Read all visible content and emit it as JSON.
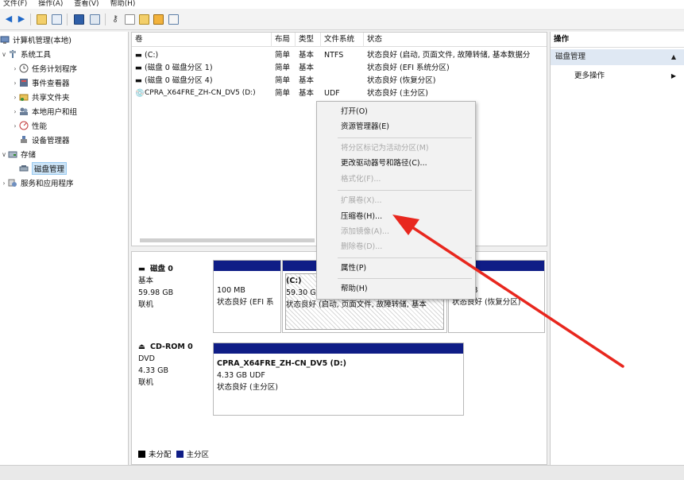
{
  "menubar": {
    "items": [
      "文件(F)",
      "操作(A)",
      "查看(V)",
      "帮助(H)"
    ]
  },
  "tree": {
    "items": [
      {
        "label": "计算机管理(本地)"
      },
      {
        "label": "系统工具"
      },
      {
        "label": "任务计划程序"
      },
      {
        "label": "事件查看器"
      },
      {
        "label": "共享文件夹"
      },
      {
        "label": "本地用户和组"
      },
      {
        "label": "性能"
      },
      {
        "label": "设备管理器"
      },
      {
        "label": "存储"
      },
      {
        "label": "磁盘管理"
      },
      {
        "label": "服务和应用程序"
      }
    ]
  },
  "volumes": {
    "headers": [
      "卷",
      "布局",
      "类型",
      "文件系统",
      "状态"
    ],
    "rows": [
      [
        "(C:)",
        "简单",
        "基本",
        "NTFS",
        "状态良好 (启动, 页面文件, 故障转储, 基本数据分"
      ],
      [
        "(磁盘 0 磁盘分区 1)",
        "简单",
        "基本",
        "",
        "状态良好 (EFI 系统分区)"
      ],
      [
        "(磁盘 0 磁盘分区 4)",
        "简单",
        "基本",
        "",
        "状态良好 (恢复分区)"
      ],
      [
        "CPRA_X64FRE_ZH-CN_DV5 (D:)",
        "简单",
        "基本",
        "UDF",
        "状态良好 (主分区)"
      ]
    ]
  },
  "disks": {
    "disk0": {
      "name": "磁盘 0",
      "type": "基本",
      "size": "59.98 GB",
      "status": "联机",
      "p1_size": "100 MB",
      "p1_status": "状态良好 (EFI 系",
      "p2_name": "(C:)",
      "p2_size": "59.30 G",
      "p2_status": "状态良好 (启动, 页面文件, 故障转储, 基本",
      "p3_size": "B",
      "p3_status": "状态良好 (恢复分区)"
    },
    "cdrom0": {
      "name": "CD-ROM 0",
      "type": "DVD",
      "size": "4.33 GB",
      "status": "联机",
      "vol_name": "CPRA_X64FRE_ZH-CN_DV5  (D:)",
      "vol_size": "4.33 GB UDF",
      "vol_status": "状态良好 (主分区)"
    },
    "legend": {
      "unallocated": "未分配",
      "primary": "主分区"
    }
  },
  "actions": {
    "title": "操作",
    "section": "磁盘管理",
    "more": "更多操作"
  },
  "context_menu": {
    "items": [
      "打开(O)",
      "资源管理器(E)",
      "将分区标记为活动分区(M)",
      "更改驱动器号和路径(C)...",
      "格式化(F)...",
      "扩展卷(X)...",
      "压缩卷(H)...",
      "添加镜像(A)...",
      "删除卷(D)...",
      "属性(P)",
      "帮助(H)"
    ]
  },
  "colors": {
    "partition_bar": "#0f1d86",
    "arrow": "#e8271e",
    "selection": "#cce4f7"
  }
}
